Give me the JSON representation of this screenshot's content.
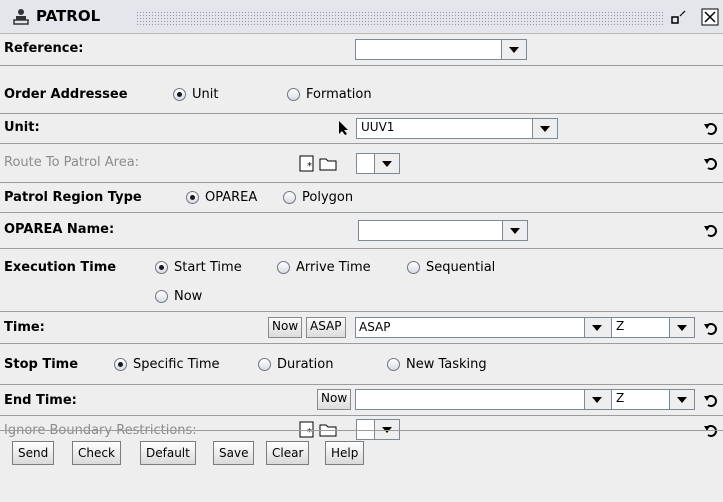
{
  "window": {
    "title": "PATROL"
  },
  "rows": {
    "reference_label": "Reference:",
    "order_addressee_label": "Order Addressee",
    "order_addressee_options": [
      "Unit",
      "Formation"
    ],
    "unit_label": "Unit:",
    "unit_value": "UUV1",
    "route_label": "Route To Patrol Area:",
    "patrol_region_label": "Patrol Region Type",
    "patrol_region_options": [
      "OPAREA",
      "Polygon"
    ],
    "oparea_label": "OPAREA Name:",
    "execution_label": "Execution Time",
    "execution_options": [
      "Start Time",
      "Arrive Time",
      "Sequential",
      "Now"
    ],
    "time_label": "Time:",
    "time_now": "Now",
    "time_asap": "ASAP",
    "time_value": "ASAP",
    "time_zone": "Z",
    "stop_label": "Stop Time",
    "stop_options": [
      "Specific Time",
      "Duration",
      "New Tasking"
    ],
    "end_label": "End Time:",
    "end_now": "Now",
    "end_zone": "Z",
    "ignore_label": "Ignore Boundary Restrictions:"
  },
  "buttons": {
    "send": "Send",
    "check": "Check",
    "default": "Default",
    "save": "Save",
    "clear": "Clear",
    "help": "Help"
  },
  "icons": {
    "title": "person-icon",
    "restore": "restore-icon",
    "close": "close-icon",
    "reset": "undo-icon",
    "cursor": "arrow-cursor-icon"
  }
}
